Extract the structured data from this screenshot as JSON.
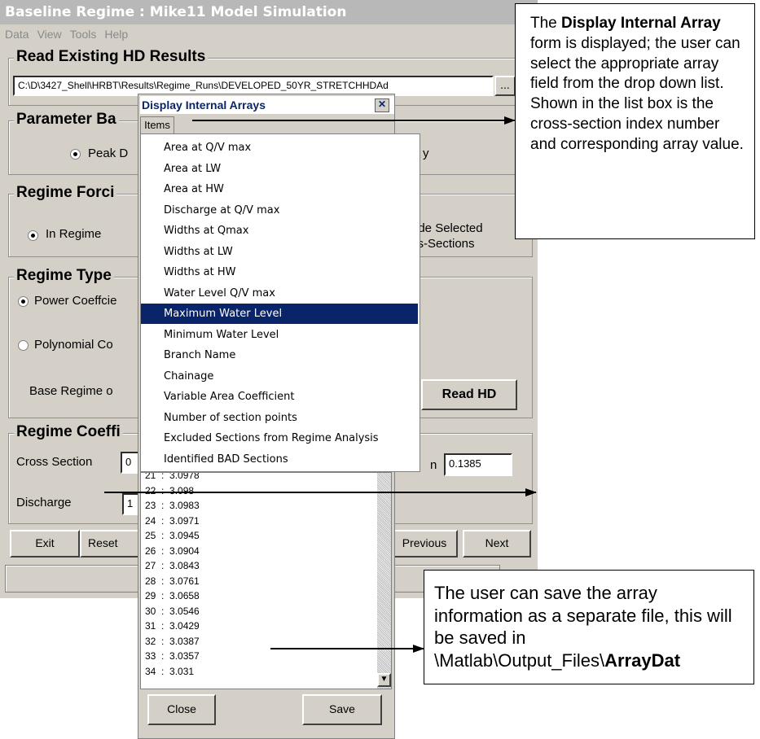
{
  "window": {
    "title": "Baseline Regime : Mike11 Model Simulation",
    "menu": [
      "Data",
      "View",
      "Tools",
      "Help"
    ]
  },
  "read_hd": {
    "legend": "Read Existing HD Results",
    "path": "C:\\D\\3427_Shell\\HRBT\\Results\\Regime_Runs\\DEVELOPED_50YR_STRETCHHDAd",
    "browse": "..."
  },
  "parameter": {
    "legend": "Parameter Ba",
    "option": "Peak D",
    "option_right": "y"
  },
  "forcing": {
    "legend": "Regime Forci",
    "option": "In Regime",
    "right_label_1": "ude Selected",
    "right_label_2": "ss-Sections"
  },
  "regime_type": {
    "legend": "Regime Type",
    "power": "Power Coeffcie",
    "polynomial": "Polynomial Co",
    "base": "Base Regime o",
    "read_hd_button": "Read HD"
  },
  "coeff": {
    "legend": "Regime Coeffi",
    "cross_section_label": "Cross Section",
    "cross_section_value": "0",
    "discharge_label": "Discharge",
    "discharge_value": "1",
    "right_value": "0.1385",
    "right_label_fragment": "n"
  },
  "bottom_buttons": {
    "exit": "Exit",
    "reset": "Reset",
    "previous": "Previous",
    "next": "Next"
  },
  "dialog": {
    "title": "Display Internal Arrays",
    "close_x": "✕",
    "menu": "Items",
    "items": [
      "Area at Q/V max",
      "Area at LW",
      "Area at HW",
      "Discharge at Q/V max",
      "Widths at Qmax",
      "Widths at LW",
      "Widths at HW",
      "Water Level Q/V max",
      "Maximum Water Level",
      "Minimum Water Level",
      "Branch Name",
      "Chainage",
      "Variable Area Coefficient",
      "Number of section points",
      "Excluded Sections from Regime Analysis",
      "Identified BAD Sections"
    ],
    "selected_index": 8,
    "list": [
      "21  :  3.0978",
      "22  :  3.098",
      "23  :  3.0983",
      "24  :  3.0971",
      "25  :  3.0945",
      "26  :  3.0904",
      "27  :  3.0843",
      "28  :  3.0761",
      "29  :  3.0658",
      "30  :  3.0546",
      "31  :  3.0429",
      "32  :  3.0387",
      "33  :  3.0357",
      "34  :  3.031"
    ],
    "close_button": "Close",
    "save_button": "Save"
  },
  "callout_top": {
    "t1": "The ",
    "b1": "Display Internal Array",
    "t2": " form is displayed; the user can select the appropriate array field from the drop down list. Shown in the list box is the cross-section index number and corresponding array value."
  },
  "callout_bottom": {
    "t1": "The user can save the array information as a separate file, this will be saved in \\Matlab\\Output_Files\\",
    "b1": "ArrayDat"
  }
}
